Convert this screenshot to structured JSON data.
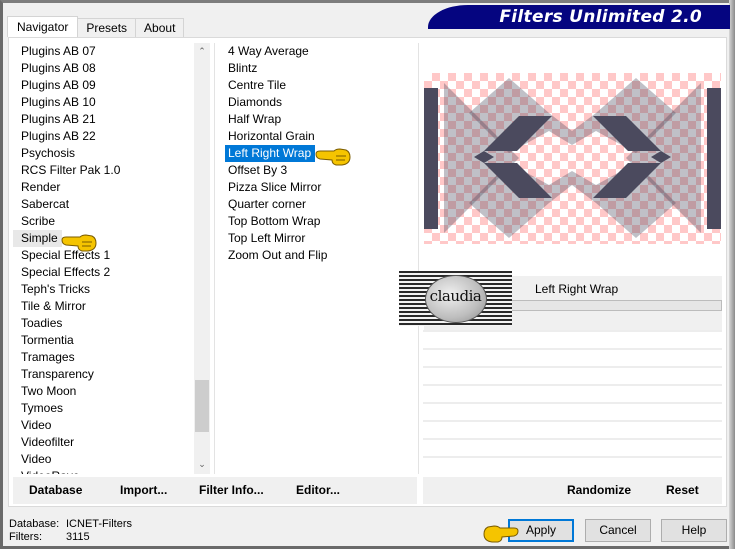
{
  "window": {
    "title": "Filters Unlimited 2.0"
  },
  "tabs": [
    {
      "label": "Navigator",
      "active": true
    },
    {
      "label": "Presets",
      "active": false
    },
    {
      "label": "About",
      "active": false
    }
  ],
  "categories": {
    "items": [
      "Plugins AB 07",
      "Plugins AB 08",
      "Plugins AB 09",
      "Plugins AB 10",
      "Plugins AB 21",
      "Plugins AB 22",
      "Psychosis",
      "RCS Filter Pak 1.0",
      "Render",
      "Sabercat",
      "Scribe",
      "Simple",
      "Special Effects 1",
      "Special Effects 2",
      "Teph's Tricks",
      "Tile & Mirror",
      "Toadies",
      "Tormentia",
      "Tramages",
      "Transparency",
      "Two Moon",
      "Tymoes",
      "Video",
      "Videofilter",
      "Video",
      "VideoRave"
    ],
    "highlighted": "Simple",
    "scroll_up_icon": "chevron-up",
    "scroll_down_icon": "chevron-down"
  },
  "filters": {
    "items": [
      "4 Way Average",
      "Blintz",
      "Centre Tile",
      "Diamonds",
      "Half Wrap",
      "Horizontal Grain",
      "Left Right Wrap",
      "Offset By 3",
      "Pizza Slice Mirror",
      "Quarter corner",
      "Top Bottom Wrap",
      "Top Left Mirror",
      "Zoom Out and Flip"
    ],
    "selected": "Left Right Wrap"
  },
  "preview": {
    "filter_name": "Left Right Wrap",
    "checker_color": "#ffc8c8",
    "shape_color": "#4b4a5e",
    "logo_text": "claudia"
  },
  "left_buttons": {
    "database": "Database",
    "import": "Import...",
    "filter_info": "Filter Info...",
    "editor": "Editor..."
  },
  "right_buttons": {
    "randomize": "Randomize",
    "reset": "Reset"
  },
  "status": {
    "database_label": "Database:",
    "database_value": "ICNET-Filters",
    "filters_label": "Filters:",
    "filters_value": "3115"
  },
  "dialog_buttons": {
    "apply": "Apply",
    "cancel": "Cancel",
    "help": "Help"
  },
  "colors": {
    "banner": "#050580",
    "selection": "#0078d7",
    "pointer_hand": "#f5c400"
  }
}
